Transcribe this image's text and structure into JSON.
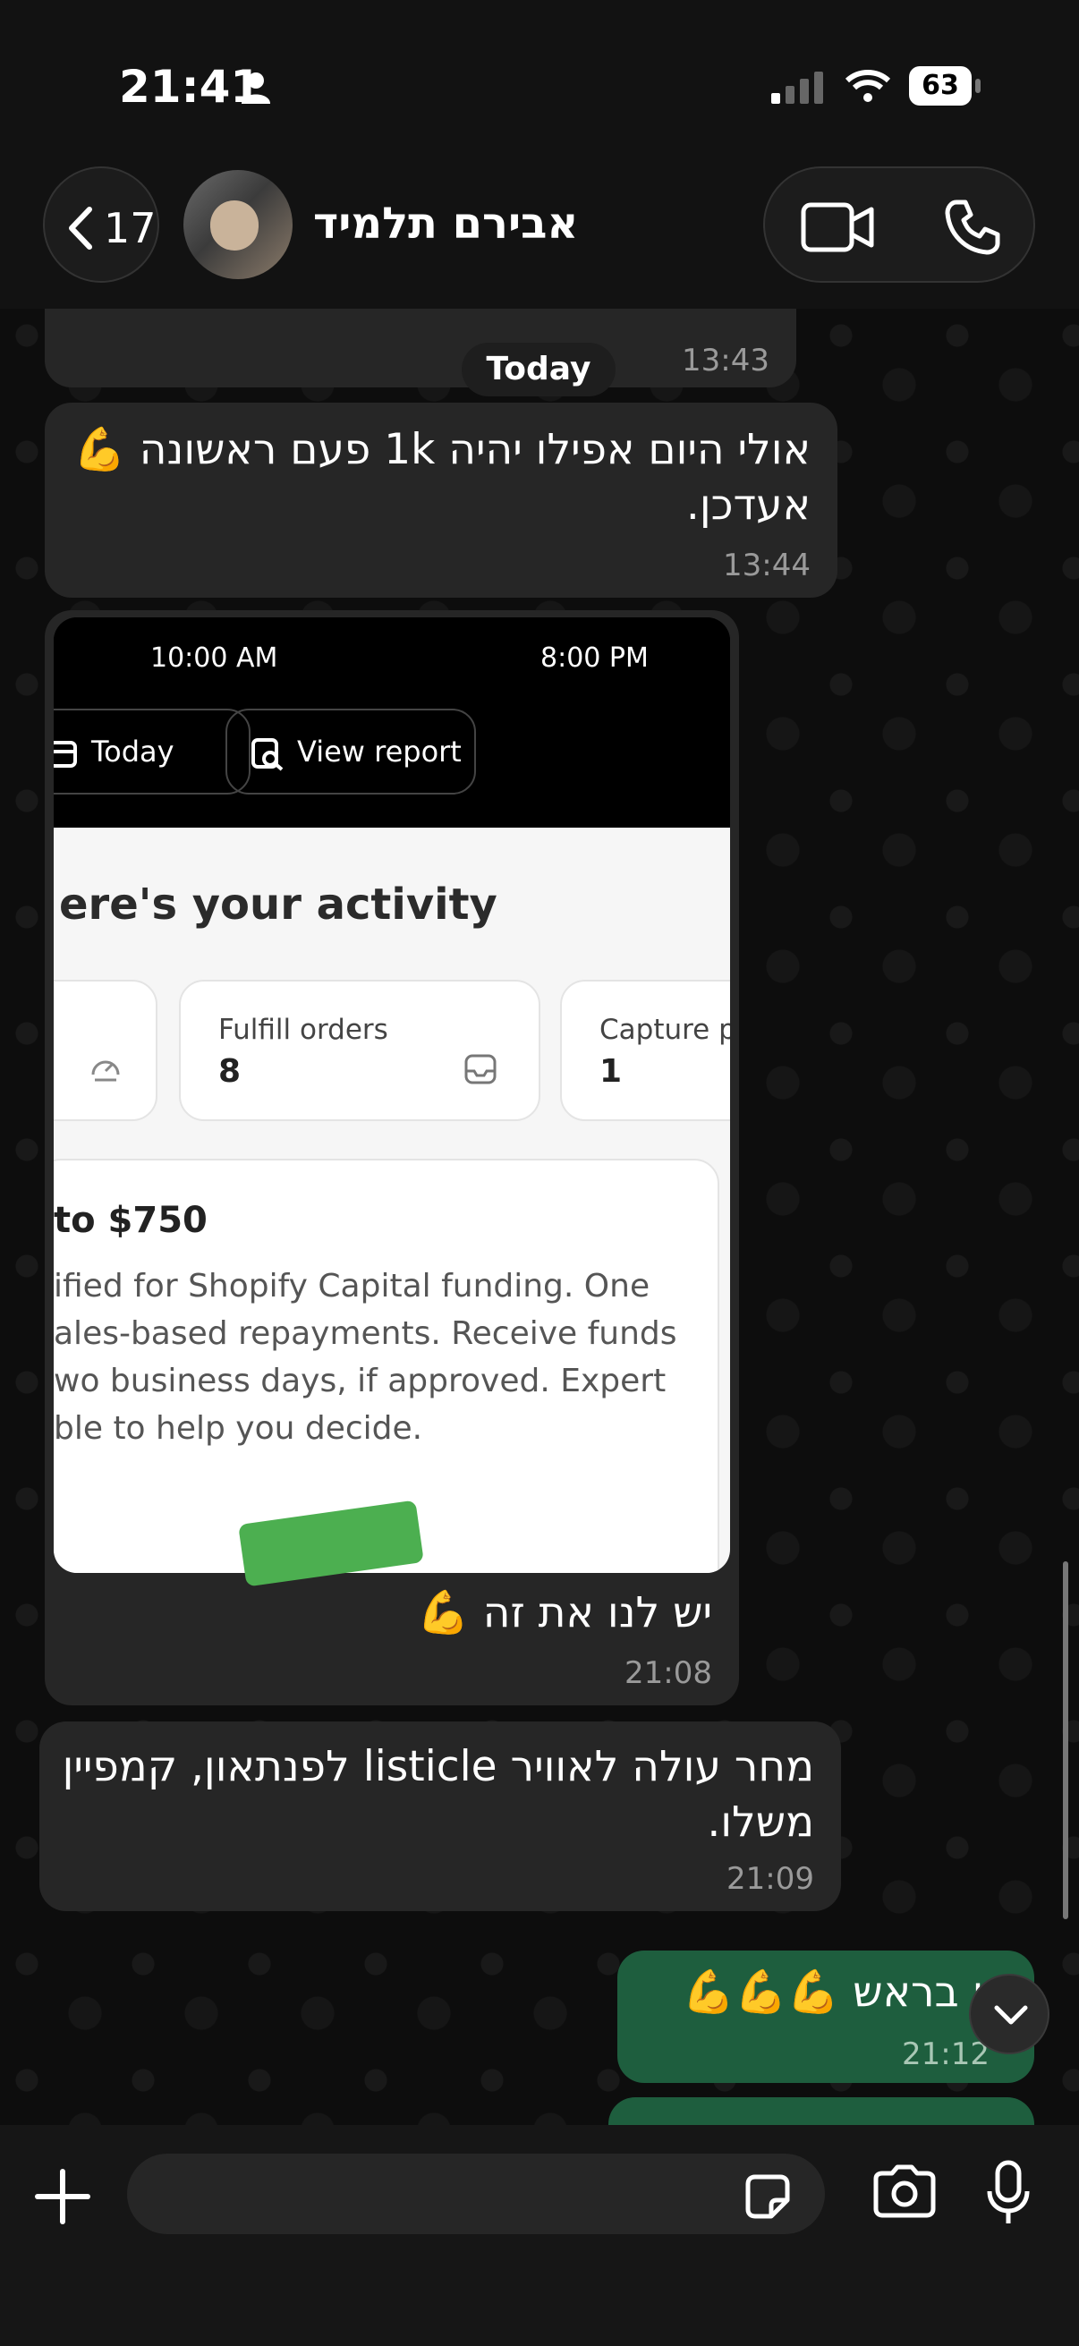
{
  "status_bar": {
    "time": "21:41",
    "battery": "63"
  },
  "header": {
    "back_count": "17",
    "contact_name": "אבירם תלמיד"
  },
  "chat": {
    "date_chip": "Today",
    "messages": [
      {
        "id": "m0",
        "text": "",
        "time": "13:43"
      },
      {
        "id": "m1",
        "text": "אולי היום אפילו יהיה 1k פעם ראשונה 💪 אעדכן.",
        "time": "13:44"
      },
      {
        "id": "m2",
        "caption": "יש לנו את זה 💪",
        "time": "21:08"
      },
      {
        "id": "m3",
        "text": "מחר עולה לאוויר listicle לפנתאון, קמפיין משלו.",
        "time": "21:09"
      },
      {
        "id": "m4",
        "text": "רו בראש 💪💪💪",
        "time": "21:12"
      }
    ]
  },
  "screenshot": {
    "time_start": "10:00 AM",
    "time_end": "8:00 PM",
    "pill_today": "Today",
    "pill_report": "View report",
    "heading": "ere's your activity",
    "cards": [
      {
        "label": "Fulfill orders",
        "value": "8"
      },
      {
        "label": "Capture p",
        "value": "1"
      }
    ],
    "promo_heading": "to $750",
    "promo_lines": [
      "ified for Shopify Capital funding. One",
      "ales-based repayments. Receive funds",
      "wo business days, if approved. Expert",
      "ble to help you decide."
    ]
  },
  "colors": {
    "outgoing_bubble": "#1e5e3e",
    "incoming_bubble": "#262626"
  }
}
